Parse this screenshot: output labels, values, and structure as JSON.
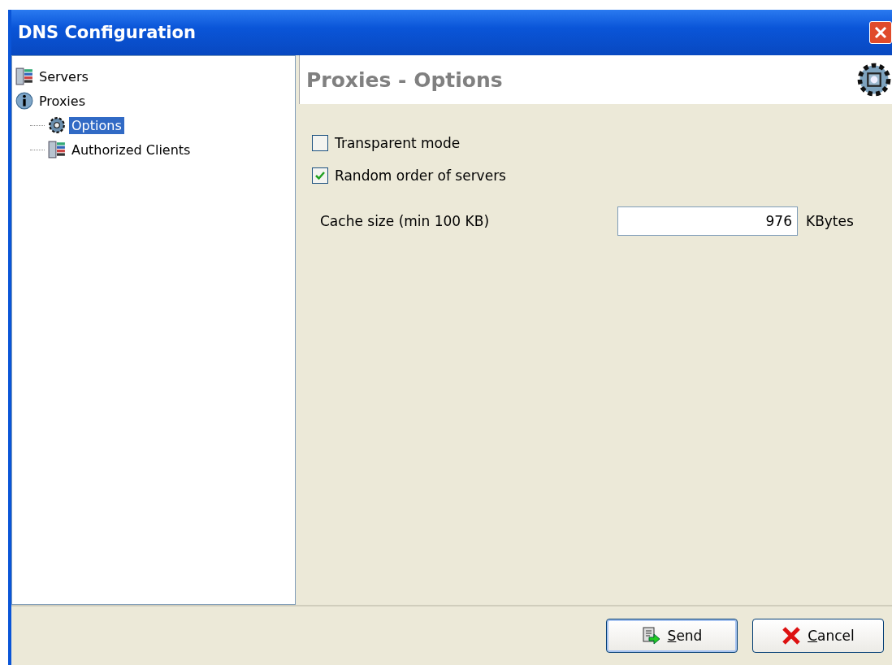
{
  "window": {
    "title": "DNS Configuration"
  },
  "tree": [
    {
      "label": "Servers",
      "kind": "servers",
      "selected": false
    },
    {
      "label": "Proxies",
      "kind": "info",
      "selected": false,
      "children": [
        {
          "label": "Options",
          "kind": "gear",
          "selected": true
        },
        {
          "label": "Authorized Clients",
          "kind": "servers",
          "selected": false
        }
      ]
    }
  ],
  "header": {
    "title": "Proxies - Options"
  },
  "options": [
    {
      "label": "Transparent mode",
      "checked": false
    },
    {
      "label": "Random order of servers",
      "checked": true
    }
  ],
  "cache": {
    "label": "Cache size (min 100 KB)",
    "value": "976",
    "unit": "KBytes"
  },
  "buttons": [
    {
      "label": "Send",
      "kind": "send"
    },
    {
      "label": "Cancel",
      "kind": "cancel"
    }
  ]
}
